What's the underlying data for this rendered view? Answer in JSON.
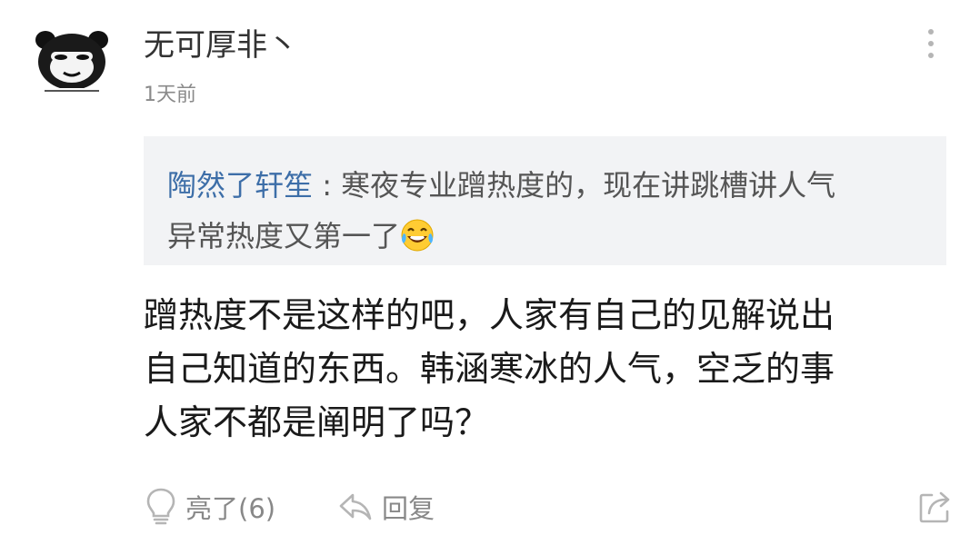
{
  "comment": {
    "username": "无可厚非丶",
    "time": "1天前",
    "quote": {
      "name": "陶然了轩笙",
      "separator": " : ",
      "line1": "寒夜专业蹭热度的，现在讲跳槽讲人气",
      "line2": "异常热度又第一了",
      "emoji": "laughing-tears-emoji"
    },
    "content": {
      "line1": "蹭热度不是这样的吧，人家有自己的见解说出",
      "line2": "自己知道的东西。韩涵寒冰的人气，空乏的事",
      "line3": "人家不都是阐明了吗？"
    }
  },
  "actions": {
    "like_label": "亮了(6)",
    "reply_label": "回复"
  },
  "icons": {
    "like": "lightbulb-icon",
    "reply": "reply-arrow-icon",
    "share": "share-icon",
    "more": "more-vertical-icon"
  },
  "colors": {
    "quote_name": "#3d6ea8",
    "quote_bg": "#f2f3f5",
    "secondary_text": "#888888"
  }
}
